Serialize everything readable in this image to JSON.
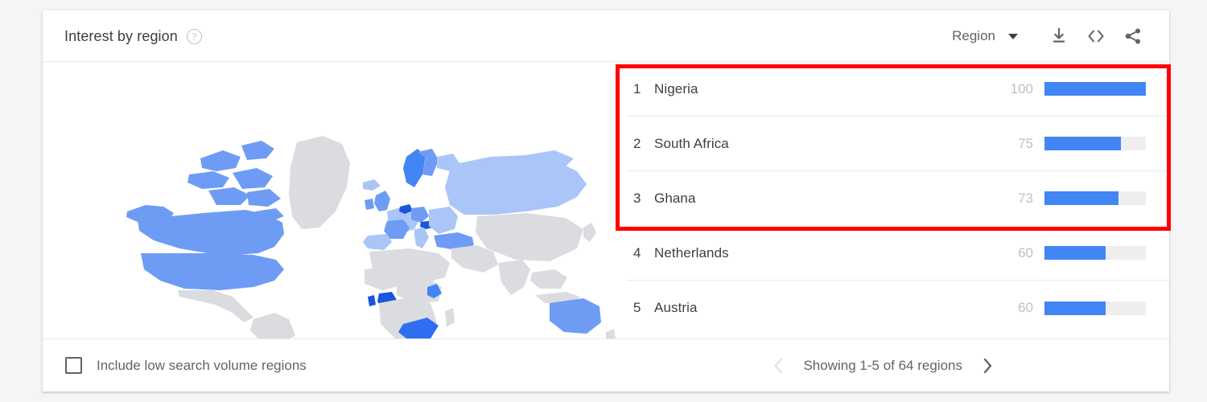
{
  "card": {
    "header": {
      "title": "Interest by region",
      "help_icon": "help-circle-icon",
      "region_dropdown_label": "Region",
      "tools": [
        {
          "name": "download-icon",
          "label": "Download"
        },
        {
          "name": "embed-code-icon",
          "label": "Embed"
        },
        {
          "name": "share-icon",
          "label": "Share"
        }
      ]
    },
    "footer": {
      "checkbox_label": "Include low search volume regions",
      "checkbox_checked": false,
      "showing_text": "Showing 1-5 of 64 regions",
      "prev_icon": "chevron-left-icon",
      "next_icon": "chevron-right-icon",
      "prev_enabled": false,
      "next_enabled": true
    }
  },
  "annotation": {
    "color": "#ff0000",
    "highlights_rows": [
      1,
      2,
      3
    ]
  },
  "colors": {
    "bar_fill": "#4285f4",
    "bar_track": "#eeeeee",
    "value_text": "#bdc1c6",
    "name_text": "#3c4043",
    "map_no_data": "#dadce0",
    "page_background": "#f5f5f5"
  },
  "chart_data": {
    "type": "bar",
    "title": "Interest by region",
    "xlabel": "",
    "ylabel": "",
    "ylim": [
      0,
      100
    ],
    "categories": [
      "Nigeria",
      "South Africa",
      "Ghana",
      "Netherlands",
      "Austria"
    ],
    "values": [
      100,
      75,
      73,
      60,
      60
    ],
    "ranks": [
      1,
      2,
      3,
      4,
      5
    ],
    "rows": [
      {
        "rank": "1",
        "name": "Nigeria",
        "value": "100",
        "pct": 100
      },
      {
        "rank": "2",
        "name": "South Africa",
        "value": "75",
        "pct": 75
      },
      {
        "rank": "3",
        "name": "Ghana",
        "value": "73",
        "pct": 73
      },
      {
        "rank": "4",
        "name": "Netherlands",
        "value": "60",
        "pct": 60
      },
      {
        "rank": "5",
        "name": "Austria",
        "value": "60",
        "pct": 60
      }
    ],
    "total_regions": 64,
    "legend": [],
    "grid": false
  }
}
